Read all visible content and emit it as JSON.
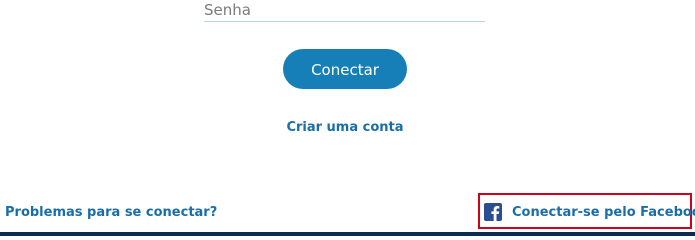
{
  "login_form": {
    "password_placeholder": "Senha",
    "connect_label": "Conectar",
    "create_account_label": "Criar uma conta"
  },
  "footer": {
    "trouble_label": "Problemas para se conectar?",
    "facebook_label": "Conectar-se pelo Facebook",
    "facebook_icon": "facebook-icon"
  },
  "colors": {
    "primary": "#167fb8",
    "link": "#1a6ea8",
    "facebook": "#2b4e93",
    "highlight_border": "#d0021b",
    "bottom_bar": "#0a2c4d"
  }
}
